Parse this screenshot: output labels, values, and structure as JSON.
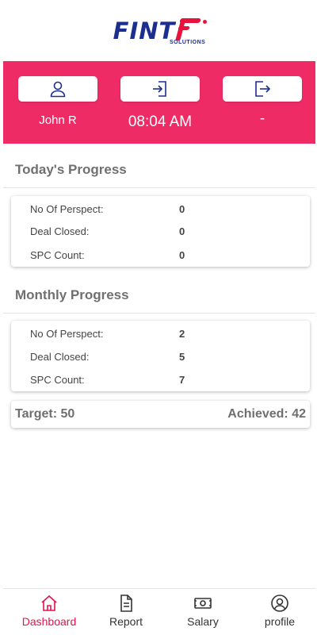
{
  "brand": {
    "name": "FINT",
    "sub": "SOLUTIONS"
  },
  "status": {
    "user_name": "John R",
    "check_in_time": "08:04 AM",
    "check_out_time": "-"
  },
  "today": {
    "title": "Today's Progress",
    "rows": [
      {
        "label": "No Of Perspect:",
        "value": "0"
      },
      {
        "label": "Deal Closed:",
        "value": "0"
      },
      {
        "label": "SPC Count:",
        "value": "0"
      }
    ]
  },
  "monthly": {
    "title": "Monthly Progress",
    "rows": [
      {
        "label": "No Of Perspect:",
        "value": "2"
      },
      {
        "label": "Deal Closed:",
        "value": "5"
      },
      {
        "label": "SPC Count:",
        "value": "7"
      }
    ]
  },
  "target": {
    "target_text": "Target: 50",
    "achieved_text": "Achieved: 42"
  },
  "nav": {
    "items": [
      {
        "label": "Dashboard",
        "icon": "home-icon"
      },
      {
        "label": "Report",
        "icon": "document-icon"
      },
      {
        "label": "Salary",
        "icon": "money-icon"
      },
      {
        "label": "profile",
        "icon": "user-circle-icon"
      }
    ],
    "active": "Dashboard"
  },
  "colors": {
    "accent": "#ef2b66",
    "brand_blue": "#1c2f8e",
    "nav_active": "#e8124d"
  }
}
